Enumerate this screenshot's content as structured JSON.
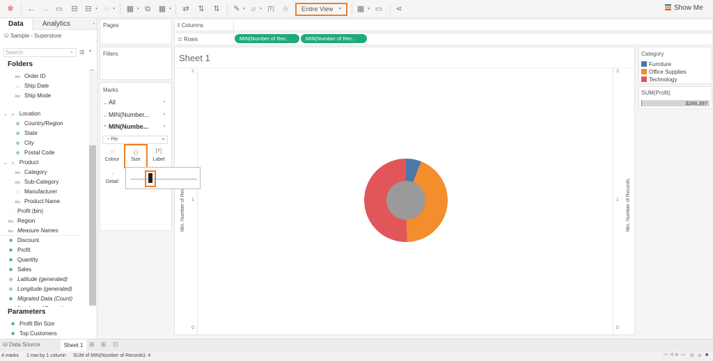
{
  "toolbar": {
    "icons": [
      "tableau-logo-icon",
      "undo-icon",
      "redo-icon",
      "save-icon",
      "new-datasource-icon",
      "pause-updates-icon",
      "refresh-icon",
      "new-worksheet-icon",
      "duplicate-icon",
      "clear-sheet-icon",
      "swap-icon",
      "sort-ascending-icon",
      "sort-descending-icon",
      "highlight-icon",
      "group-icon",
      "label-icon",
      "pin-icon",
      "show-cards-icon",
      "presentation-icon",
      "share-icon"
    ],
    "fit_label": "Entire View",
    "show_me": "Show Me"
  },
  "data_pane": {
    "tabs": [
      "Data",
      "Analytics"
    ],
    "datasource": "Sample - Superstore",
    "search_placeholder": "Search",
    "folders_header": "Folders",
    "fields": [
      {
        "label": "Order ID",
        "type": "Abc"
      },
      {
        "label": "Ship Date",
        "type": "date"
      },
      {
        "label": "Ship Mode",
        "type": "Abc"
      },
      {
        "label": "Location",
        "type": "hierarchy"
      },
      {
        "label": "Country/Region",
        "type": "geo"
      },
      {
        "label": "State",
        "type": "geo"
      },
      {
        "label": "City",
        "type": "geo"
      },
      {
        "label": "Postal Code",
        "type": "geo"
      },
      {
        "label": "Product",
        "type": "hierarchy"
      },
      {
        "label": "Category",
        "type": "Abc"
      },
      {
        "label": "Sub-Category",
        "type": "Abc"
      },
      {
        "label": "Manufacturer",
        "type": "group"
      },
      {
        "label": "Product Name",
        "type": "Abc"
      },
      {
        "label": "Profit (bin)",
        "type": "bin"
      },
      {
        "label": "Region",
        "type": "Abc"
      },
      {
        "label": "Measure Names",
        "type": "Abc"
      },
      {
        "label": "Discount",
        "type": "measure"
      },
      {
        "label": "Profit",
        "type": "measure"
      },
      {
        "label": "Quantity",
        "type": "measure"
      },
      {
        "label": "Sales",
        "type": "measure"
      },
      {
        "label": "Latitude (generated)",
        "type": "geo-measure"
      },
      {
        "label": "Longitude (generated)",
        "type": "geo-measure"
      },
      {
        "label": "Migrated Data (Count)",
        "type": "measure"
      },
      {
        "label": "Number of Records",
        "type": "measure"
      }
    ],
    "parameters_header": "Parameters",
    "parameters": [
      "Profit Bin Size",
      "Top Customers"
    ]
  },
  "shelves": {
    "pages": "Pages",
    "filters": "Filters",
    "columns": "Columns",
    "rows": "Rows",
    "row_pills": [
      "MIN(Number of Rec..",
      "MIN(Number of Rec.."
    ]
  },
  "marks": {
    "title": "Marks",
    "rows": [
      "All",
      "MIN(Number...",
      "MIN(Numbe..."
    ],
    "mark_type": "Pie",
    "buttons": [
      "Colour",
      "Size",
      "Label",
      "Detail"
    ],
    "size_slider_value": 0.3
  },
  "sheet": {
    "title": "Sheet 1",
    "y_axis_label": "Min. Number of Records",
    "ticks": [
      "2",
      "1",
      "0"
    ]
  },
  "legend": {
    "title": "Category",
    "items": [
      {
        "label": "Furniture",
        "color": "#4e79a7"
      },
      {
        "label": "Office Supplies",
        "color": "#f28e2b"
      },
      {
        "label": "Technology",
        "color": "#e15759"
      }
    ]
  },
  "sum_profit": {
    "title": "SUM(Profit)",
    "value": "$286,397"
  },
  "chart_data": {
    "type": "pie",
    "title": "Sheet 1",
    "categories": [
      "Furniture",
      "Office Supplies",
      "Technology"
    ],
    "values": [
      6,
      43.5,
      50.5
    ],
    "colors": [
      "#4e79a7",
      "#f28e2b",
      "#e15759"
    ],
    "inner_circle_color": "#9a9a9a",
    "ylabel": "Min. Number of Records",
    "ylim": [
      0,
      2
    ],
    "y_ticks": [
      0,
      1,
      2
    ]
  },
  "bottom_tabs": {
    "datasource": "Data Source",
    "sheet": "Sheet 1"
  },
  "status": {
    "marks": "4 marks",
    "dims": "1 row by 1 column",
    "summary": "SUM of MIN(Number of Records): 4"
  }
}
